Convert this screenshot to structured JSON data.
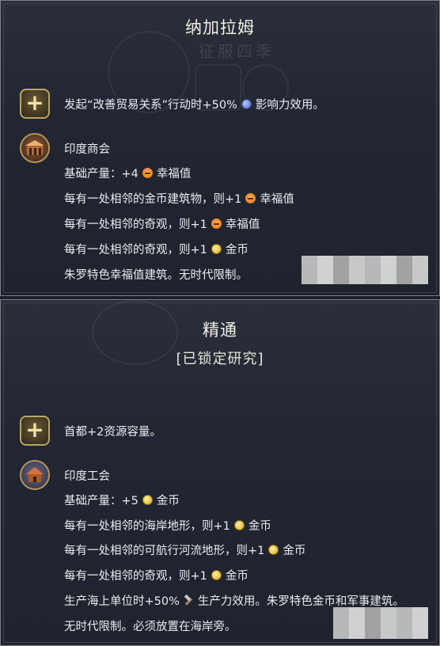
{
  "top_panel": {
    "title": "纳加拉姆",
    "watermark_text": "征服四季",
    "bonus_text": "发起“改善贸易关系”行动时+50%",
    "bonus_suffix": "影响力效用。",
    "building": {
      "name": "印度商会",
      "lines": [
        {
          "pre": "基础产量：+4",
          "icon": "amenity",
          "post": "幸福值"
        },
        {
          "pre": "每有一处相邻的金币建筑物，则+1",
          "icon": "amenity",
          "post": "幸福值"
        },
        {
          "pre": "每有一处相邻的奇观，则+1",
          "icon": "amenity",
          "post": "幸福值"
        },
        {
          "pre": "每有一处相邻的奇观，则+1",
          "icon": "gold",
          "post": "金币"
        },
        {
          "pre": "朱罗特色幸福值建筑。无时代限制。",
          "icon": "",
          "post": ""
        }
      ]
    }
  },
  "bottom_panel": {
    "title": "精通",
    "subtitle": "[已锁定研究]",
    "bonus_text": "首都+2资源容量。",
    "building": {
      "name": "印度工会",
      "lines": [
        {
          "pre": "基础产量：+5",
          "icon": "gold",
          "post": "金币"
        },
        {
          "pre": "每有一处相邻的海岸地形，则+1",
          "icon": "gold",
          "post": "金币"
        },
        {
          "pre": "每有一处相邻的可航行河流地形，则+1",
          "icon": "gold",
          "post": "金币"
        },
        {
          "pre": "每有一处相邻的奇观，则+1",
          "icon": "gold",
          "post": "金币"
        },
        {
          "pre": "生产海上单位时+50%",
          "icon": "hammer",
          "post": "生产力效用。朱罗特色金币和军事建筑。"
        },
        {
          "pre": "无时代限制。必须放置在海岸旁。",
          "icon": "",
          "post": ""
        }
      ]
    }
  },
  "icons": {
    "bonus": "plus-icon",
    "building_top": "trade-house-icon",
    "building_bottom": "guild-house-icon",
    "amenity": "happiness-icon",
    "gold": "gold-coin-icon",
    "globe": "influence-globe-icon",
    "hammer": "production-hammer-icon"
  }
}
